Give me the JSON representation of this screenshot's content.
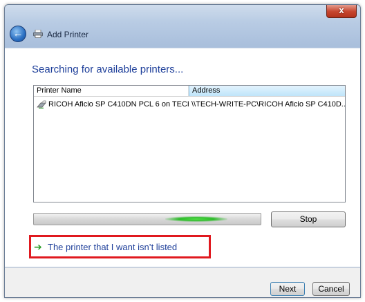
{
  "window": {
    "title": "Add Printer",
    "close_glyph": "x"
  },
  "icons": {
    "back": "back-arrow-icon",
    "title": "printer-icon",
    "row": "printer-icon",
    "link": "green-arrow-icon"
  },
  "main": {
    "heading": "Searching for available printers...",
    "table": {
      "columns": [
        "Printer Name",
        "Address"
      ],
      "rows": [
        {
          "name": "RICOH Aficio SP C410DN PCL 6 on TECH...",
          "address": "\\\\TECH-WRITE-PC\\RICOH Aficio SP C410D..."
        }
      ]
    },
    "progress_state": "searching (indeterminate)",
    "stop_label": "Stop",
    "link_text": "The printer that I want isn’t listed"
  },
  "footer": {
    "next_label": "Next",
    "cancel_label": "Cancel"
  },
  "colors": {
    "heading": "#1e3f9a",
    "highlight_box": "#e0191f",
    "progress_glow": "#2dbb2a"
  }
}
